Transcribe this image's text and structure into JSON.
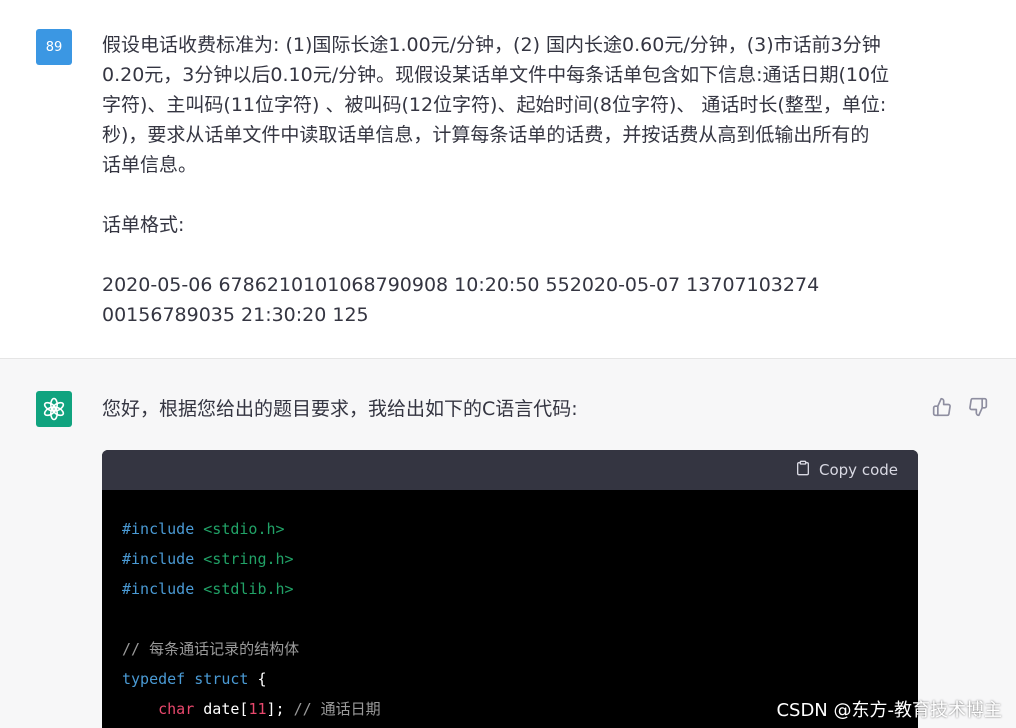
{
  "user_message": {
    "avatar_label": "89",
    "lines": [
      "假设电话收费标准为: (1)国际长途1.00元/分钟，(2) 国内长途0.60元/分钟，(3)市话前3分钟",
      "0.20元，3分钟以后0.10元/分钟。现假设某话单文件中每条话单包含如下信息:通话日期(10位",
      "字符)、主叫码(11位字符) 、被叫码(12位字符)、起始时间(8位字符)、 通话时长(整型，单位:",
      "秒)，要求从话单文件中读取话单信息，计算每条话单的话费，并按话费从高到低输出所有的",
      "话单信息。"
    ],
    "format_label": "话单格式:",
    "sample_lines": [
      "2020-05-06 6786210101068790908 10:20:50 552020-05-07 13707103274",
      "00156789035 21:30:20 125"
    ]
  },
  "assistant_message": {
    "avatar_icon": "openai-logo-icon",
    "text": "您好，根据您给出的题目要求，我给出如下的C语言代码:",
    "thumbs_up_icon": "thumbs-up-icon",
    "thumbs_down_icon": "thumbs-down-icon",
    "code": {
      "copy_label": "Copy code",
      "include_kw": "#include",
      "inc1": "<stdio.h>",
      "inc2": "<string.h>",
      "inc3": "<stdlib.h>",
      "comment1": "// 每条通话记录的结构体",
      "typedef_kw": "typedef",
      "struct_kw": "struct",
      "brace_open": "{",
      "char_kw": "char",
      "date_field": "date[",
      "date_size": "11",
      "date_end": "];",
      "comment2": "// 通话日期"
    }
  },
  "watermark": "CSDN @东方-教育技术博主",
  "colors": {
    "user_avatar": "#3b97e3",
    "bot_avatar": "#10a37f",
    "code_bg": "#000000",
    "code_header_bg": "#343541",
    "keyword": "#4a9ad4",
    "string": "#21a267",
    "comment": "#9a9a9a",
    "type": "#e9486d"
  }
}
